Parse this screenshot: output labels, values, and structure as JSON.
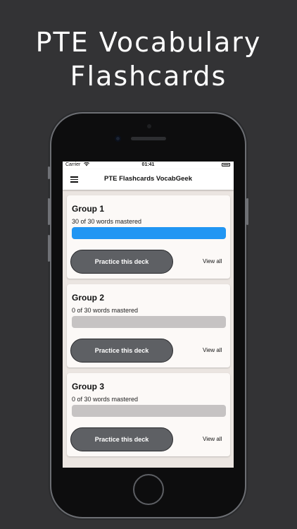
{
  "headline": {
    "line1": "PTE Vocabulary",
    "line2": "Flashcards"
  },
  "status_bar": {
    "carrier": "Carrier",
    "time": "01:41"
  },
  "app_bar": {
    "title": "PTE Flashcards VocabGeek"
  },
  "decks": [
    {
      "title": "Group 1",
      "mastered_text": "30 of 30 words mastered",
      "progress": 1.0,
      "practice_label": "Practice this deck",
      "view_all_label": "View all"
    },
    {
      "title": "Group 2",
      "mastered_text": "0 of 30 words mastered",
      "progress": 0.0,
      "practice_label": "Practice this deck",
      "view_all_label": "View all"
    },
    {
      "title": "Group 3",
      "mastered_text": "0 of 30 words mastered",
      "progress": 0.0,
      "practice_label": "Practice this deck",
      "view_all_label": "View all"
    }
  ],
  "colors": {
    "background": "#333335",
    "progress_fill": "#2196f3",
    "progress_track": "#c6c3c3",
    "button": "#5e6064"
  },
  "icons": {
    "menu": "hamburger-menu-icon",
    "wifi": "wifi-icon",
    "battery": "battery-icon"
  }
}
